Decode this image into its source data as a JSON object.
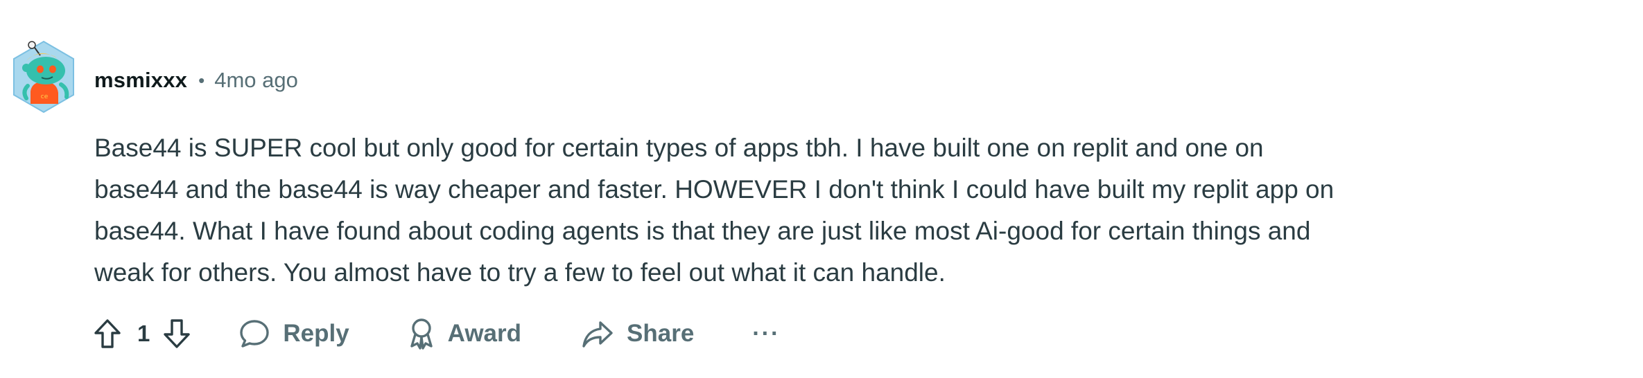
{
  "comment": {
    "author": "msmixxx",
    "separator": "•",
    "timestamp": "4mo ago",
    "avatar_icon": "snoo-avatar-icon",
    "body": "Base44 is SUPER cool but only good for certain types of apps tbh. I have built one on replit and one on base44 and the base44 is way cheaper and faster. HOWEVER I don't think I could have built my replit app on base44. What I have found about coding agents is that they are just like most Ai-good for certain things and weak for others. You almost have to try a few to feel out what it can handle.",
    "body_lines": [
      "Base44 is SUPER cool but only good for certain types of apps tbh. I have built one on replit and one on",
      "base44 and the base44 is way cheaper and faster. HOWEVER I don't think I could have built my replit app on",
      "base44. What I have found about coding agents is that they are just like most Ai-good for certain things and",
      "weak for others. You almost have to try a few to feel out what it can handle."
    ]
  },
  "actions": {
    "score": "1",
    "upvote_icon": "upvote-arrow-icon",
    "downvote_icon": "downvote-arrow-icon",
    "reply_label": "Reply",
    "reply_icon": "speech-bubble-icon",
    "award_label": "Award",
    "award_icon": "award-ribbon-icon",
    "share_label": "Share",
    "share_icon": "share-arrow-icon",
    "more_label": "···",
    "more_icon": "more-options-icon"
  },
  "colors": {
    "text_primary": "#0f1a1c",
    "text_body": "#2a3c42",
    "text_secondary": "#576f76",
    "background": "#ffffff",
    "avatar_teal": "#2fb8a8",
    "avatar_orange": "#ff4500",
    "avatar_bg": "#9fd2e8"
  }
}
